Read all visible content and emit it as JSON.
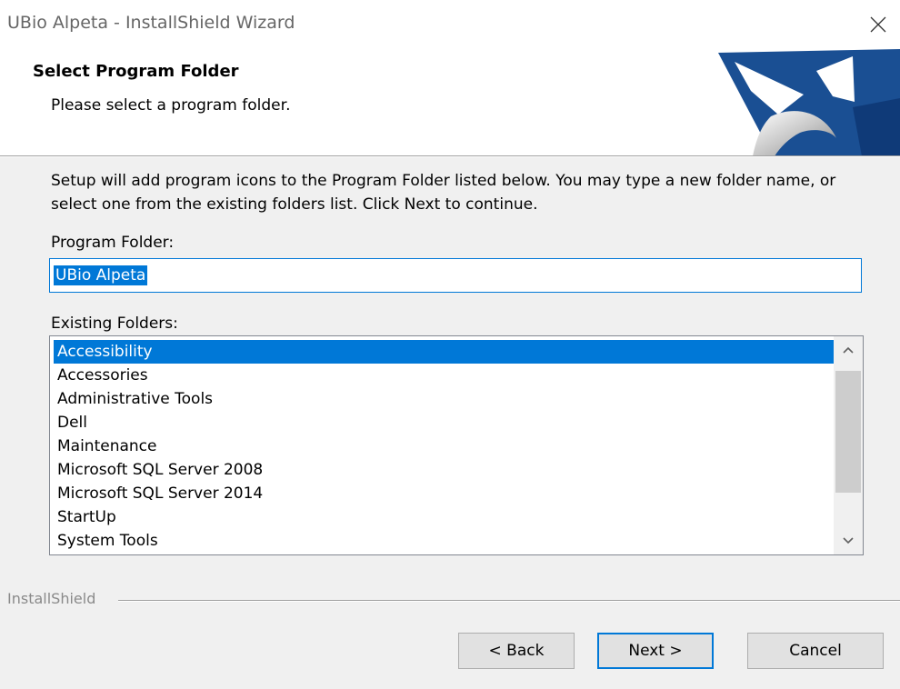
{
  "window": {
    "title": "UBio Alpeta - InstallShield Wizard",
    "close_icon": "close-icon"
  },
  "header": {
    "title": "Select Program Folder",
    "subtitle": "Please select a program folder."
  },
  "body": {
    "description": "Setup will add program icons to the Program Folder listed below.  You may type a new folder name, or select one from the existing folders list.  Click Next to continue.",
    "program_folder_label": "Program Folder:",
    "program_folder_value": "UBio Alpeta",
    "existing_folders_label": "Existing Folders:",
    "existing_folders": [
      "Accessibility",
      "Accessories",
      "Administrative Tools",
      "Dell",
      "Maintenance",
      "Microsoft SQL Server 2008",
      "Microsoft SQL Server 2014",
      "StartUp",
      "System Tools"
    ],
    "selected_folder": "Accessibility"
  },
  "footer": {
    "brand": "InstallShield",
    "back_label": "< Back",
    "next_label": "Next >",
    "cancel_label": "Cancel"
  },
  "colors": {
    "accent": "#0078d7",
    "logo_blue": "#1a4f93"
  }
}
